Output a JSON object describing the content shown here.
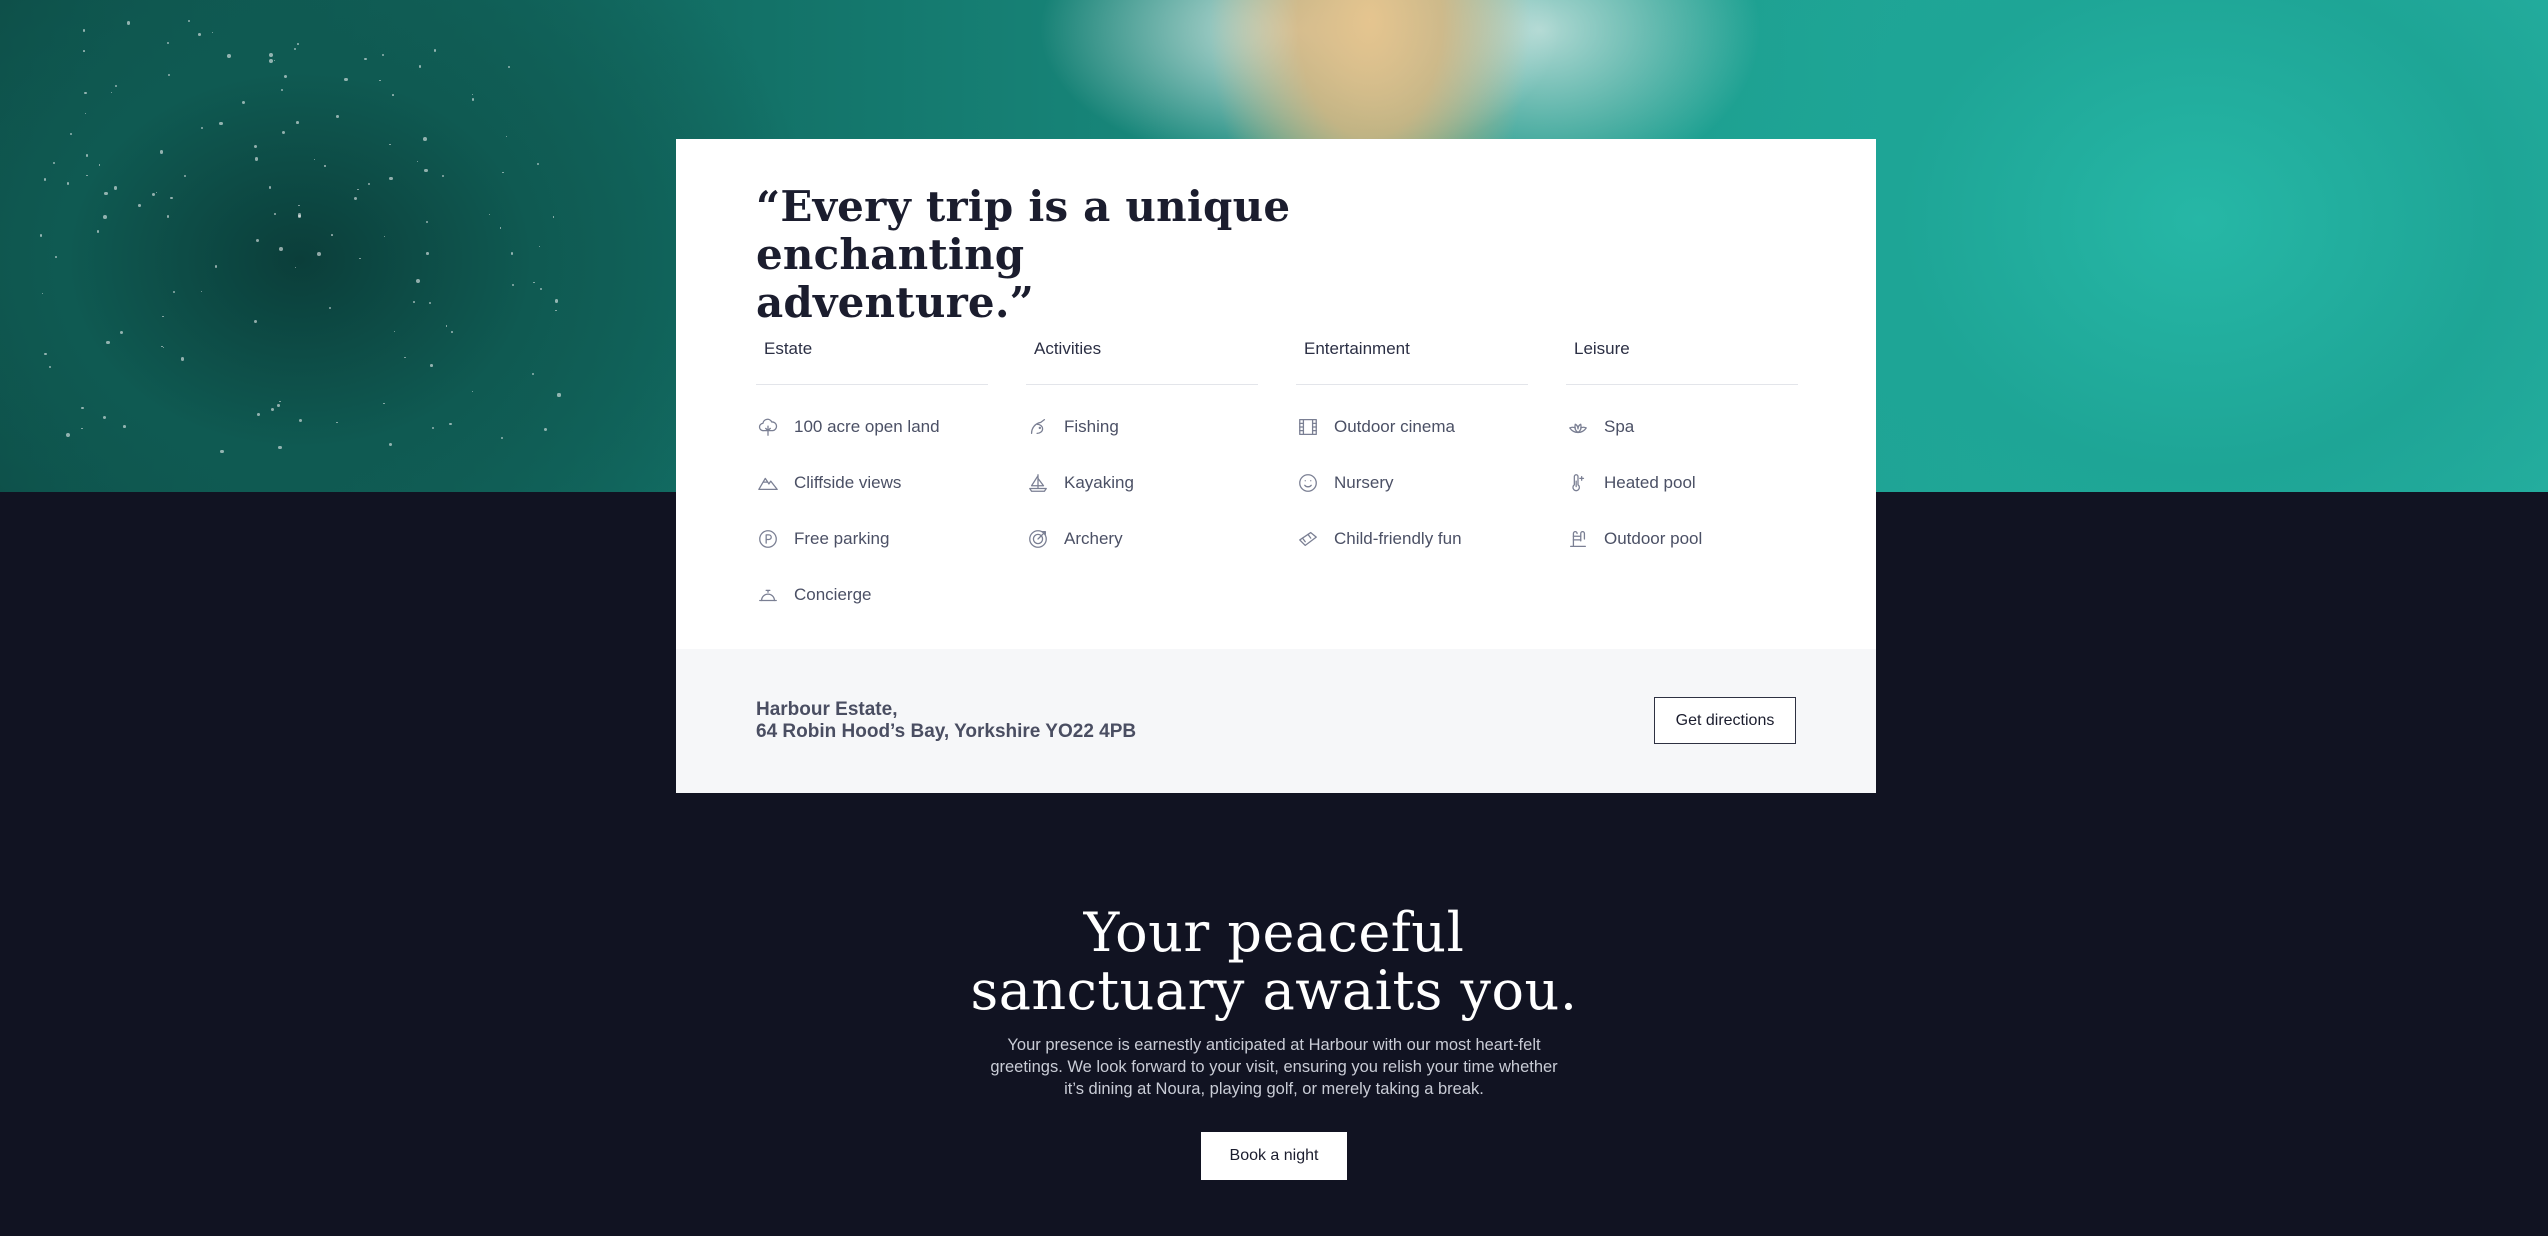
{
  "hero": {
    "image": "aerial-ocean-beach-photo"
  },
  "card": {
    "quote_line1": "“Every trip is a unique",
    "quote_line2": "enchanting adventure.”",
    "columns": [
      {
        "title": "Estate",
        "items": [
          {
            "label": "100 acre open land",
            "icon": "cloud-tree-icon"
          },
          {
            "label": "Cliffside views",
            "icon": "mountain-icon"
          },
          {
            "label": "Free parking",
            "icon": "parking-icon"
          },
          {
            "label": "Concierge",
            "icon": "service-bell-icon"
          }
        ]
      },
      {
        "title": "Activities",
        "items": [
          {
            "label": "Fishing",
            "icon": "fishing-icon"
          },
          {
            "label": "Kayaking",
            "icon": "sailboat-icon"
          },
          {
            "label": "Archery",
            "icon": "target-icon"
          }
        ]
      },
      {
        "title": "Entertainment",
        "items": [
          {
            "label": "Outdoor cinema",
            "icon": "film-icon"
          },
          {
            "label": "Nursery",
            "icon": "smiley-icon"
          },
          {
            "label": "Child-friendly fun",
            "icon": "ticket-icon"
          }
        ]
      },
      {
        "title": "Leisure",
        "items": [
          {
            "label": "Spa",
            "icon": "lotus-icon"
          },
          {
            "label": "Heated pool",
            "icon": "thermometer-icon"
          },
          {
            "label": "Outdoor pool",
            "icon": "pool-icon"
          }
        ]
      }
    ],
    "address_line1": "Harbour Estate,",
    "address_line2": "64 Robin Hood’s Bay, Yorkshire YO22 4PB",
    "directions_label": "Get directions"
  },
  "cta": {
    "heading_line1": "Your peaceful",
    "heading_line2": "sanctuary awaits you.",
    "body": "Your presence is earnestly anticipated at Harbour with our most heart-felt greetings. We look forward to your visit, ensuring you relish your time whether it’s dining at Noura, playing golf, or merely taking a break.",
    "button_label": "Book a night"
  },
  "colors": {
    "dark_bg": "#111322",
    "card_bg": "#ffffff",
    "addr_bg": "#f6f7f9",
    "icon": "#7a7f93"
  }
}
